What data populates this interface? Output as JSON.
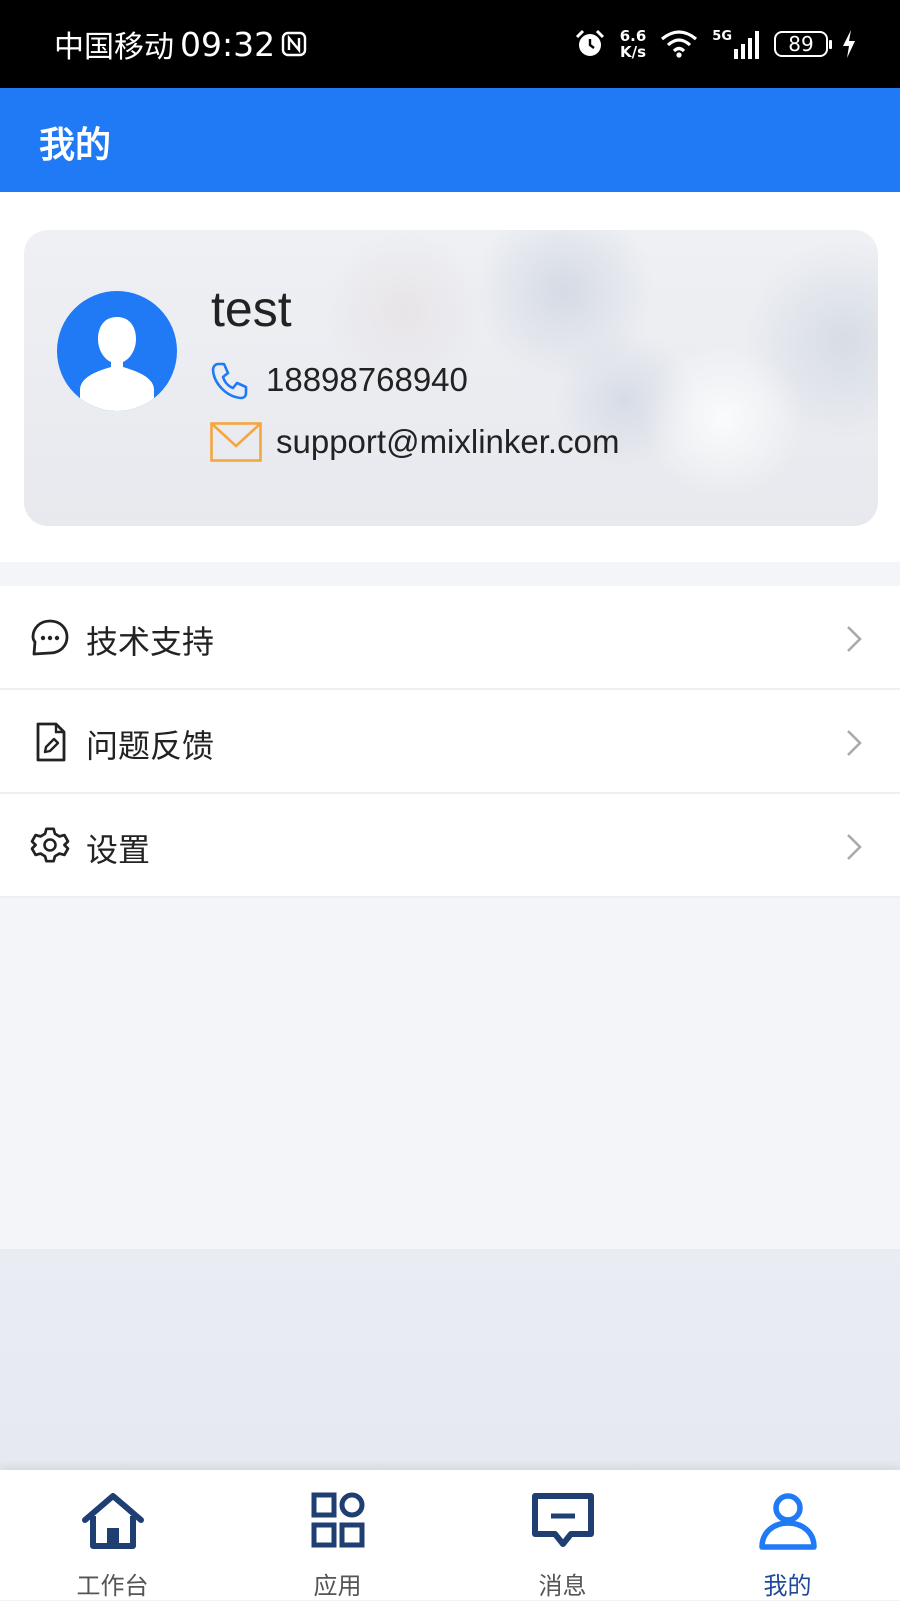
{
  "status_bar": {
    "carrier": "中国移动",
    "time": "09:32",
    "net_speed_value": "6.6",
    "net_speed_unit": "K/s",
    "network": "5G",
    "battery": "89"
  },
  "header": {
    "title": "我的"
  },
  "profile": {
    "name": "test",
    "phone": "18898768940",
    "email": "support@mixlinker.com"
  },
  "menu": {
    "items": [
      {
        "label": "技术支持",
        "icon": "chat-bubble-icon"
      },
      {
        "label": "问题反馈",
        "icon": "document-edit-icon"
      },
      {
        "label": "设置",
        "icon": "gear-icon"
      }
    ]
  },
  "tab_bar": {
    "tabs": [
      {
        "label": "工作台",
        "icon": "home-icon",
        "active": false
      },
      {
        "label": "应用",
        "icon": "apps-grid-icon",
        "active": false
      },
      {
        "label": "消息",
        "icon": "message-icon",
        "active": false
      },
      {
        "label": "我的",
        "icon": "person-icon",
        "active": true
      }
    ]
  },
  "colors": {
    "primary": "#2079f5",
    "tab_icon": "#1f3f72",
    "email_icon": "#f4a640"
  }
}
